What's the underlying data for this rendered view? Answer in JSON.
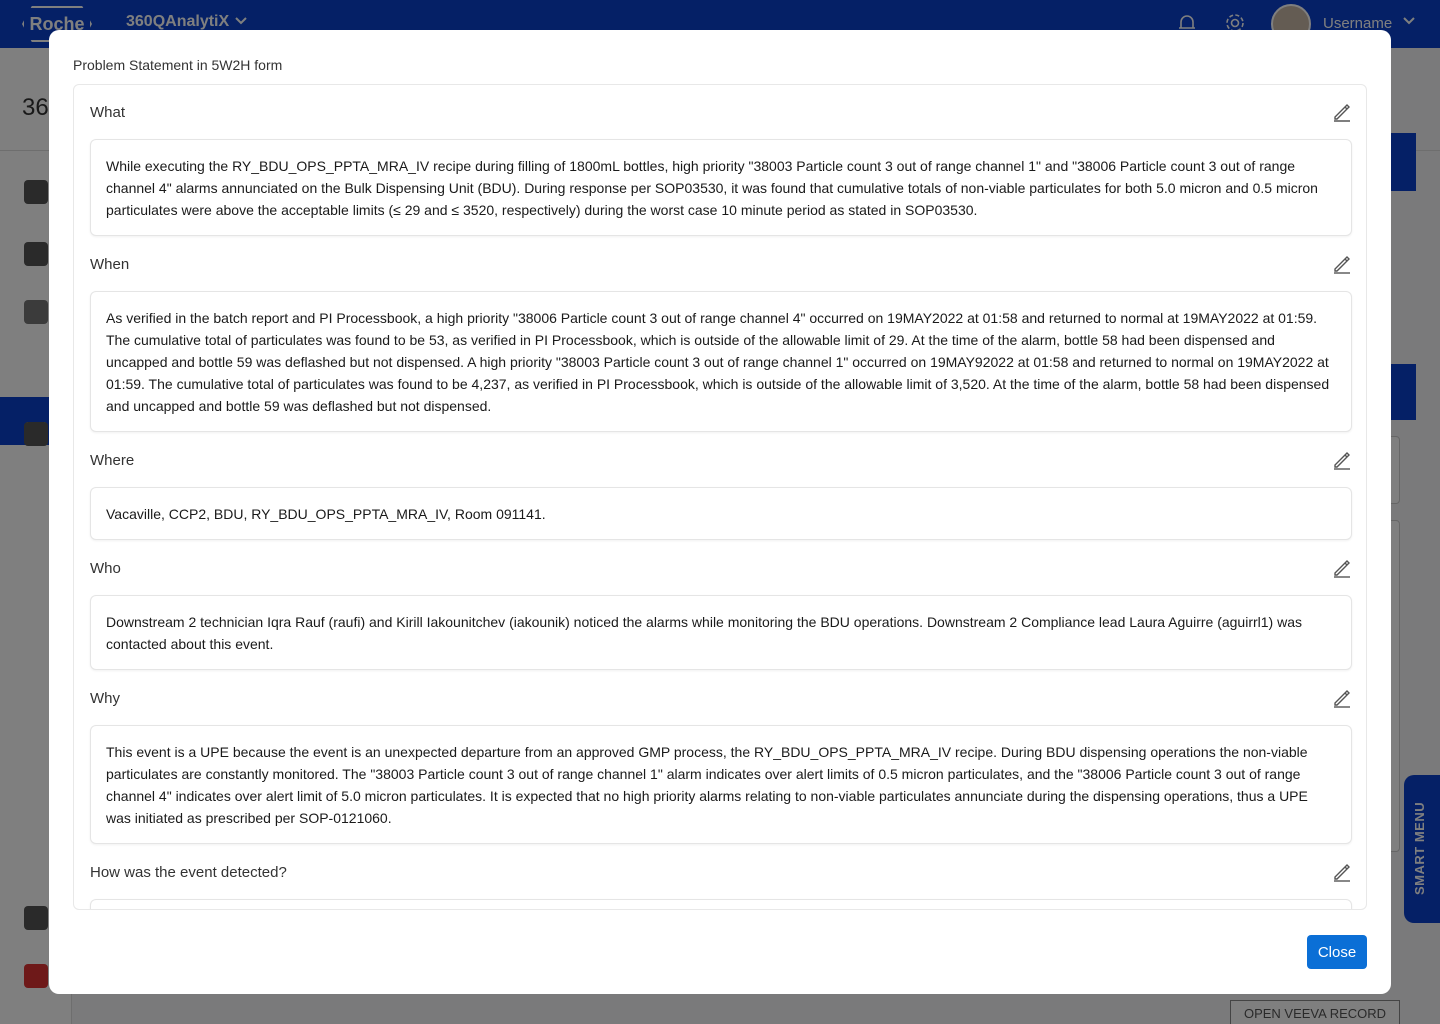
{
  "app": {
    "logo_text": "Roche",
    "name": "360QAnalytiX",
    "username": "Username",
    "page_title_partial": "36",
    "smart_menu_label": "SMART MENU",
    "veeva_button": "OPEN VEEVA RECORD"
  },
  "modal": {
    "title": "Problem Statement in 5W2H form",
    "close_label": "Close",
    "sections": [
      {
        "label": "What",
        "text": "While executing the RY_BDU_OPS_PPTA_MRA_IV recipe during filling of 1800mL bottles, high priority \"38003 Particle count 3 out of range channel 1\" and \"38006 Particle count 3 out of range channel 4\" alarms annunciated on the Bulk Dispensing Unit (BDU). During response per SOP03530, it was found that cumulative totals of non-viable particulates for both 5.0 micron and 0.5 micron particulates were above the acceptable limits (≤ 29 and ≤ 3520, respectively) during the worst case 10 minute period as stated in SOP03530."
      },
      {
        "label": "When",
        "text": "As verified in the batch report and PI Processbook, a high priority \"38006 Particle count 3 out of range channel 4\" occurred on 19MAY2022 at 01:58 and returned to normal at 19MAY2022 at 01:59. The cumulative total of particulates was found to be 53, as verified in PI Processbook, which is outside of the allowable limit of 29. At the time of the alarm, bottle 58 had been dispensed and uncapped and bottle 59 was deflashed but not dispensed. A high priority \"38003 Particle count 3 out of range channel 1\" occurred on 19MAY92022 at 01:58 and returned to normal on 19MAY2022 at 01:59. The cumulative total of particulates was found to be 4,237, as verified in PI Processbook, which is outside of the allowable limit of 3,520. At the time of the alarm, bottle 58 had been dispensed and uncapped and bottle 59 was deflashed but not dispensed."
      },
      {
        "label": "Where",
        "text": " Vacaville, CCP2, BDU, RY_BDU_OPS_PPTA_MRA_IV, Room 091141."
      },
      {
        "label": "Who",
        "text": "Downstream 2 technician Iqra Rauf (raufi) and Kirill Iakounitchev (iakounik) noticed the alarms while monitoring the BDU operations. Downstream 2 Compliance lead Laura Aguirre (aguirrl1) was contacted about this event."
      },
      {
        "label": "Why",
        "text": "This event is a UPE because the event is an unexpected departure from an approved GMP process, the RY_BDU_OPS_PPTA_MRA_IV recipe. During BDU dispensing operations the non-viable particulates are constantly monitored. The \"38003 Particle count 3 out of range channel 1\" alarm indicates over alert limits of 0.5 micron particulates, and the \"38006 Particle count 3 out of range channel 4\" indicates over alert limit of 5.0 micron particulates. It is expected that no high priority alarms relating to non-viable particulates annunciate during the dispensing operations, thus a UPE was initiated as prescribed per SOP-0121060."
      },
      {
        "label": "How was the event detected?",
        "text": ""
      }
    ]
  }
}
